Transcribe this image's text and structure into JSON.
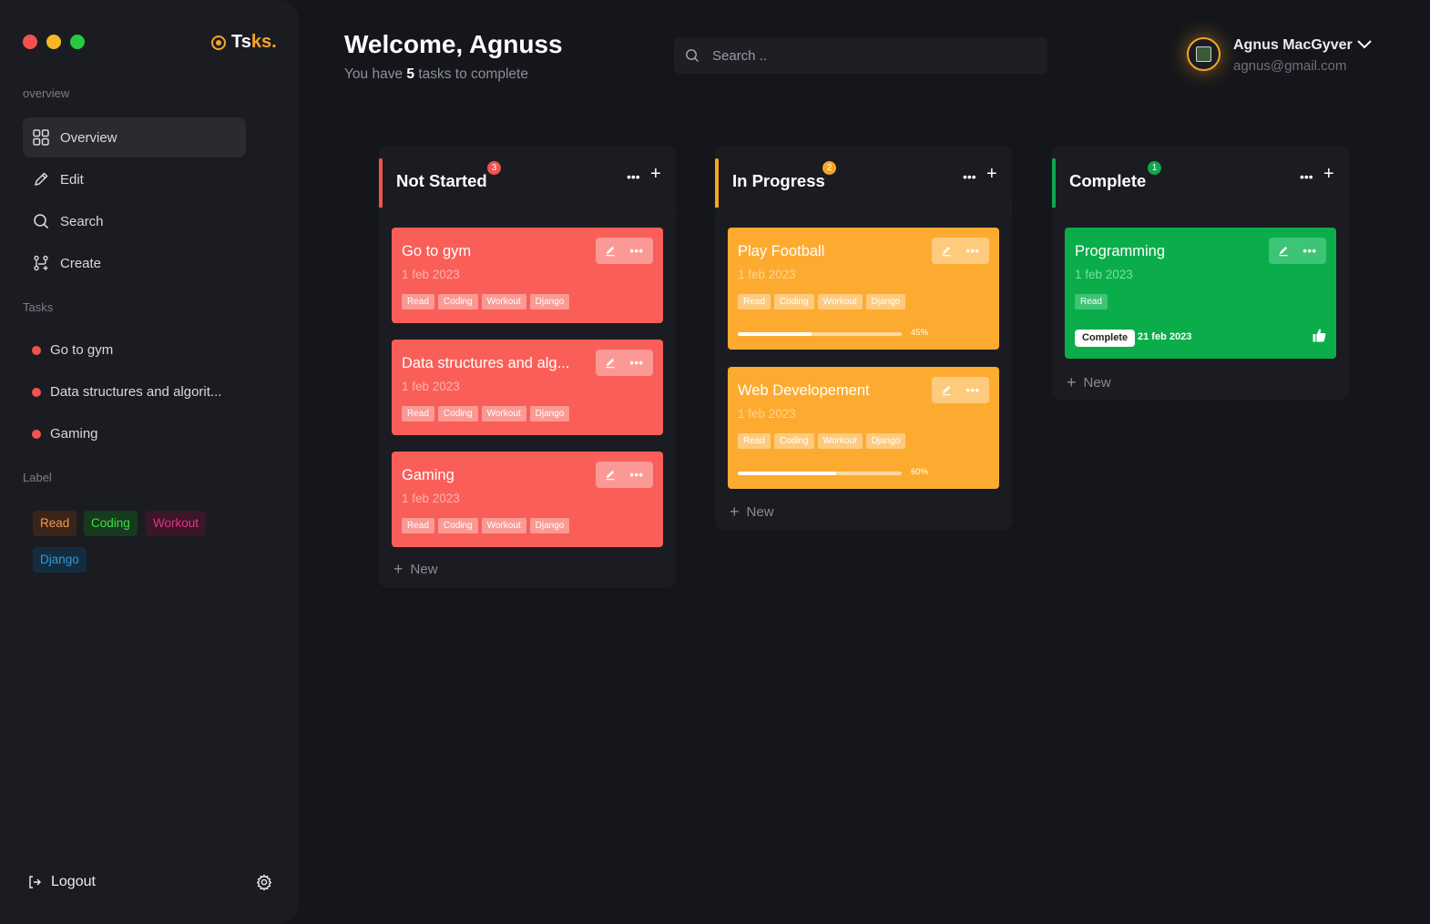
{
  "app": {
    "logo_part1": "Ts",
    "logo_part2": "ks.",
    "traffic_colors": [
      "#f4524f",
      "#f6b822",
      "#28c940"
    ]
  },
  "sidebar": {
    "overview_label": "overview",
    "nav": [
      {
        "label": "Overview",
        "icon": "grid-icon",
        "active": true
      },
      {
        "label": "Edit",
        "icon": "pencil-icon",
        "active": false
      },
      {
        "label": "Search",
        "icon": "search-icon",
        "active": false
      },
      {
        "label": "Create",
        "icon": "create-icon",
        "active": false
      }
    ],
    "tasks_label": "Tasks",
    "tasks": [
      {
        "label": "Go to gym"
      },
      {
        "label": "Data structures and algorit..."
      },
      {
        "label": "Gaming"
      }
    ],
    "label_section": "Label",
    "labels": [
      {
        "label": "Read",
        "fg": "#f39a4c",
        "bg": "#3a2418"
      },
      {
        "label": "Coding",
        "fg": "#3fe048",
        "bg": "#163a1e"
      },
      {
        "label": "Workout",
        "fg": "#e0328a",
        "bg": "#3a1628"
      },
      {
        "label": "Django",
        "fg": "#2f9bd8",
        "bg": "#142c3f"
      }
    ],
    "logout_label": "Logout"
  },
  "header": {
    "welcome": "Welcome, Agnuss",
    "subtitle_before": "You have",
    "task_count": "5",
    "subtitle_after": "tasks to complete",
    "search_placeholder": "Search ..",
    "user_name": "Agnus MacGyver",
    "user_email": "agnus@gmail.com"
  },
  "columns": [
    {
      "title": "Not Started",
      "count": "3",
      "accent": "#f4524f",
      "cards": [
        {
          "title": "Go to gym",
          "date": "1 feb 2023",
          "tags": [
            "Read",
            "Coding",
            "Workout",
            "Django"
          ]
        },
        {
          "title": "Data structures and alg...",
          "date": "1 feb 2023",
          "tags": [
            "Read",
            "Coding",
            "Workout",
            "Django"
          ]
        },
        {
          "title": "Gaming",
          "date": "1 feb 2023",
          "tags": [
            "Read",
            "Coding",
            "Workout",
            "Django"
          ]
        }
      ],
      "new_label": "New"
    },
    {
      "title": "In Progress",
      "count": "2",
      "accent": "#f5a623",
      "cards": [
        {
          "title": "Play Football",
          "date": "1 feb 2023",
          "tags": [
            "Read",
            "Coding",
            "Workout",
            "Django"
          ],
          "progress": 45,
          "progress_label": "45%"
        },
        {
          "title": "Web Developement",
          "date": "1 feb 2023",
          "tags": [
            "Read",
            "Coding",
            "Workout",
            "Django"
          ],
          "progress": 60,
          "progress_label": "60%"
        }
      ],
      "new_label": "New"
    },
    {
      "title": "Complete",
      "count": "1",
      "accent": "#0fa84c",
      "cards": [
        {
          "title": "Programming",
          "date": "1 feb 2023",
          "tags": [
            "Read"
          ],
          "status": "Complete",
          "completed_on": "21 feb 2023"
        }
      ],
      "new_label": "New"
    }
  ]
}
